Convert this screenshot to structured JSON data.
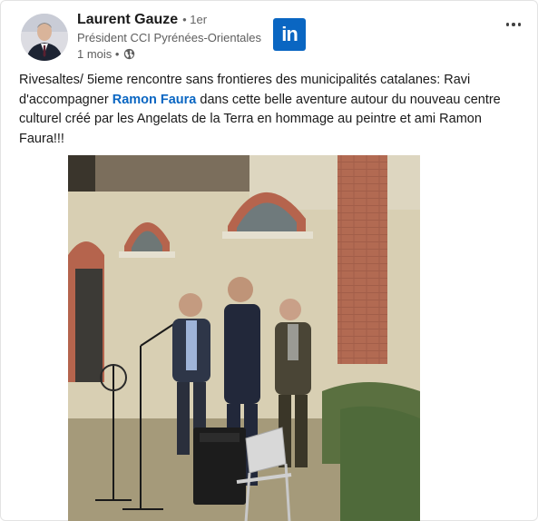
{
  "author": {
    "name": "Laurent Gauze",
    "degree": "• 1er",
    "headline": "Président CCI Pyrénées-Orientales",
    "time": "1 mois •"
  },
  "icons": {
    "logo": "linkedin-logo",
    "logo_text": "in",
    "globe": "globe-icon",
    "more": "more-options-icon"
  },
  "post": {
    "text_before": "Rivesaltes/ 5ieme rencontre sans frontieres des municipalités catalanes: Ravi d'accompagner ",
    "mention": "Ramon Faura",
    "text_after": " dans cette belle aventure autour du nouveau centre culturel créé par les Angelats de la Terra en hommage au peintre et ami Ramon Faura!!!"
  },
  "colors": {
    "linkedin_blue": "#0a66c2",
    "text": "#191919",
    "secondary_text": "#5e5e5e"
  }
}
